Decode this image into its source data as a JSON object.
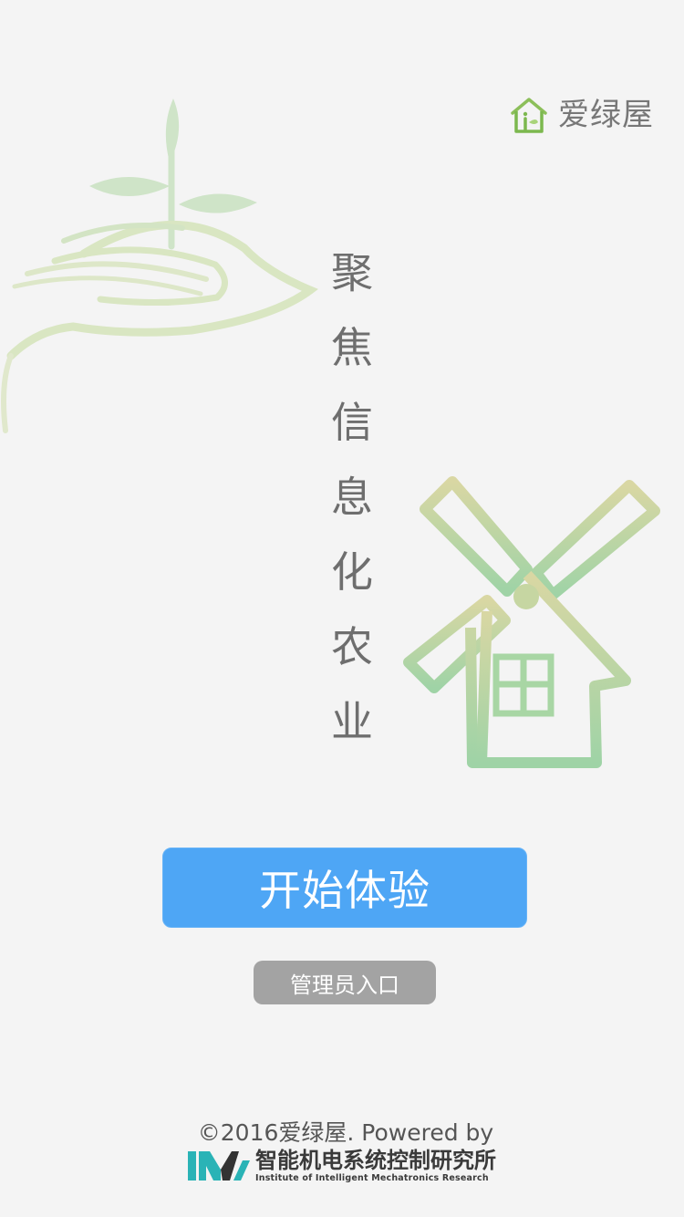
{
  "brand": {
    "name": "爱绿屋"
  },
  "slogan": {
    "chars": [
      "聚",
      "焦",
      "信",
      "息",
      "化",
      "农",
      "业"
    ]
  },
  "actions": {
    "start_label": "开始体验",
    "admin_label": "管理员入口"
  },
  "footer": {
    "copyright": "©2016爱绿屋. Powered by",
    "institute_cn": "智能机电系统控制研究所",
    "institute_en": "Institute of Intelligent Mechatronics Research"
  },
  "colors": {
    "background": "#f4f4f4",
    "primary_button": "#4ea6f5",
    "secondary_button": "#a3a3a3",
    "illustration_green": "#c4dfbf",
    "illustration_olive": "#d6d6a6",
    "logo_teal": "#2ab3b6"
  }
}
